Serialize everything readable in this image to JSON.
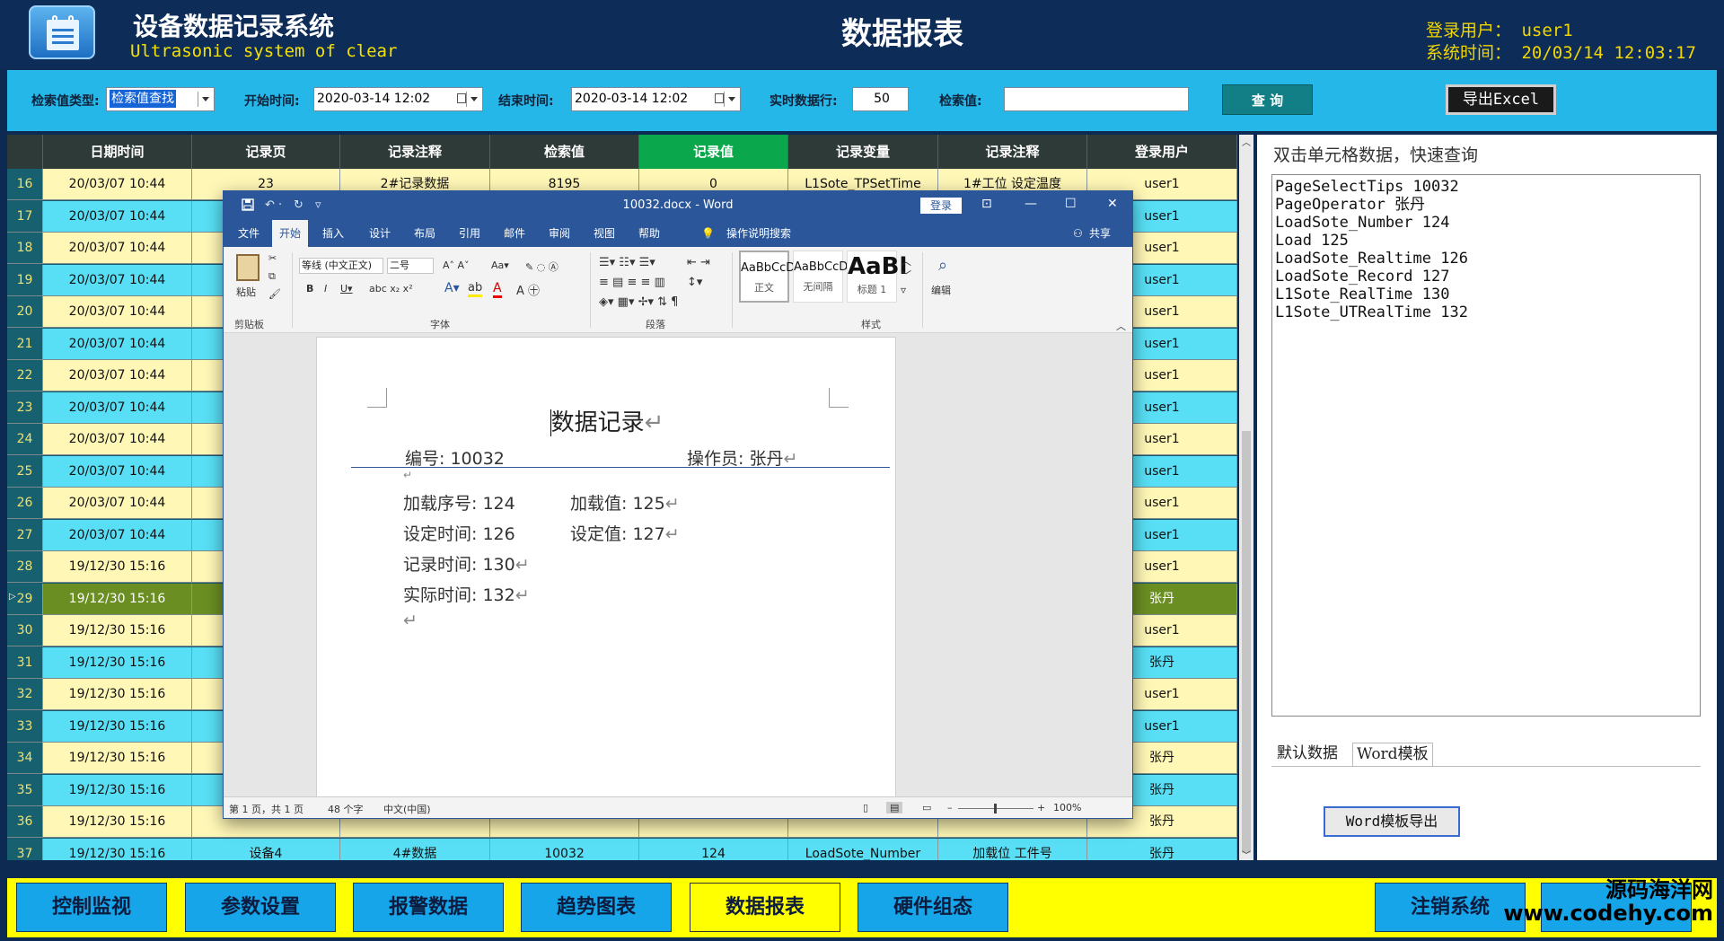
{
  "header": {
    "title": "设备数据记录系统",
    "subtitle": "Ultrasonic system of clear",
    "page_title": "数据报表",
    "login_label": "登录用户：",
    "login_user": "user1",
    "time_label": "系统时间：",
    "time_value": "20/03/14 12:03:17"
  },
  "filter": {
    "search_type_label": "检索值类型:",
    "search_type_value": "检索值查找",
    "start_label": "开始时间:",
    "start_value": "2020-03-14 12:02",
    "end_label": "结束时间:",
    "end_value": "2020-03-14 12:02",
    "rows_label": "实时数据行:",
    "rows_value": "50",
    "search_value_label": "检索值:",
    "search_value": "",
    "query_label": "查 询",
    "export_label": "导出Excel"
  },
  "grid": {
    "columns": [
      "日期时间",
      "记录页",
      "记录注释",
      "检索值",
      "记录值",
      "记录变量",
      "记录注释",
      "登录用户"
    ],
    "rows": [
      {
        "n": "16",
        "date": "20/03/07 10:44",
        "page": "23",
        "note": "2#记录数据",
        "key": "8195",
        "val": "0",
        "var": "L1Sote_TPSetTime",
        "note2": "1#工位 设定温度",
        "user": "user1"
      },
      {
        "n": "17",
        "date": "20/03/07 10:44",
        "user": "user1"
      },
      {
        "n": "18",
        "date": "20/03/07 10:44",
        "user": "user1"
      },
      {
        "n": "19",
        "date": "20/03/07 10:44",
        "user": "user1"
      },
      {
        "n": "20",
        "date": "20/03/07 10:44",
        "user": "user1"
      },
      {
        "n": "21",
        "date": "20/03/07 10:44",
        "user": "user1"
      },
      {
        "n": "22",
        "date": "20/03/07 10:44",
        "user": "user1"
      },
      {
        "n": "23",
        "date": "20/03/07 10:44",
        "user": "user1"
      },
      {
        "n": "24",
        "date": "20/03/07 10:44",
        "user": "user1"
      },
      {
        "n": "25",
        "date": "20/03/07 10:44",
        "user": "user1"
      },
      {
        "n": "26",
        "date": "20/03/07 10:44",
        "user": "user1"
      },
      {
        "n": "27",
        "date": "20/03/07 10:44",
        "user": "user1"
      },
      {
        "n": "28",
        "date": "19/12/30 15:16",
        "user": "user1"
      },
      {
        "n": "29",
        "date": "19/12/30 15:16",
        "user": "张丹",
        "selected": true
      },
      {
        "n": "30",
        "date": "19/12/30 15:16",
        "user": "user1"
      },
      {
        "n": "31",
        "date": "19/12/30 15:16",
        "user": "张丹"
      },
      {
        "n": "32",
        "date": "19/12/30 15:16",
        "user": "user1"
      },
      {
        "n": "33",
        "date": "19/12/30 15:16",
        "user": "user1"
      },
      {
        "n": "34",
        "date": "19/12/30 15:16",
        "user": "张丹"
      },
      {
        "n": "35",
        "date": "19/12/30 15:16",
        "user": "张丹"
      },
      {
        "n": "36",
        "date": "19/12/30 15:16",
        "user": "张丹"
      },
      {
        "n": "37",
        "date": "19/12/30 15:16",
        "page": "设备4",
        "note": "4#数据",
        "key": "10032",
        "val": "124",
        "var": "LoadSote_Number",
        "note2": "加载位 工件号",
        "user": "张丹"
      }
    ]
  },
  "right_panel": {
    "title": "双击单元格数据，快速查询",
    "lines": [
      "PageSelectTips 10032",
      "PageOperator 张丹",
      "LoadSote_Number 124",
      "Load 125",
      "LoadSote_Realtime 126",
      "LoadSote_Record 127",
      "L1Sote_RealTime 130",
      "L1Sote_UTRealTime 132"
    ],
    "tab_default": "默认数据",
    "tab_word": "Word模板",
    "export_button": "Word模板导出"
  },
  "nav": {
    "items": [
      "控制监视",
      "参数设置",
      "报警数据",
      "趋势图表",
      "数据报表",
      "硬件组态"
    ],
    "logout": "注销系统",
    "watermark_line1": "源码海洋网",
    "watermark_line2": "www.codehy.com"
  },
  "word": {
    "title": "10032.docx  -  Word",
    "login": "登录",
    "tabs": [
      "文件",
      "开始",
      "插入",
      "设计",
      "布局",
      "引用",
      "邮件",
      "审阅",
      "视图",
      "帮助"
    ],
    "tell_me": "操作说明搜索",
    "share": "共享",
    "groups": {
      "clipboard": "剪贴板",
      "font": "字体",
      "paragraph": "段落",
      "styles": "样式"
    },
    "paste": "粘贴",
    "font_name": "等线 (中文正文)",
    "font_size": "二号",
    "edit": "编辑",
    "styles": [
      {
        "sample": "AaBbCcDd",
        "name": "正文"
      },
      {
        "sample": "AaBbCcDd",
        "name": "无间隔"
      },
      {
        "sample": "AaBl",
        "name": "标题 1"
      }
    ],
    "doc": {
      "title": "数据记录",
      "number_label": "编号:",
      "number": "10032",
      "operator_label": "操作员:",
      "operator": "张丹",
      "load_seq_label": "加载序号:",
      "load_seq": "124",
      "load_val_label": "加载值:",
      "load_val": "125",
      "set_time_label": "设定时间:",
      "set_time": "126",
      "set_val_label": "设定值:",
      "set_val": "127",
      "rec_time_label": "记录时间:",
      "rec_time": "130",
      "act_time_label": "实际时间:",
      "act_time": "132"
    },
    "status": {
      "page": "第 1 页，共 1 页",
      "words": "48 个字",
      "lang": "中文(中国)",
      "zoom": "100%"
    }
  }
}
